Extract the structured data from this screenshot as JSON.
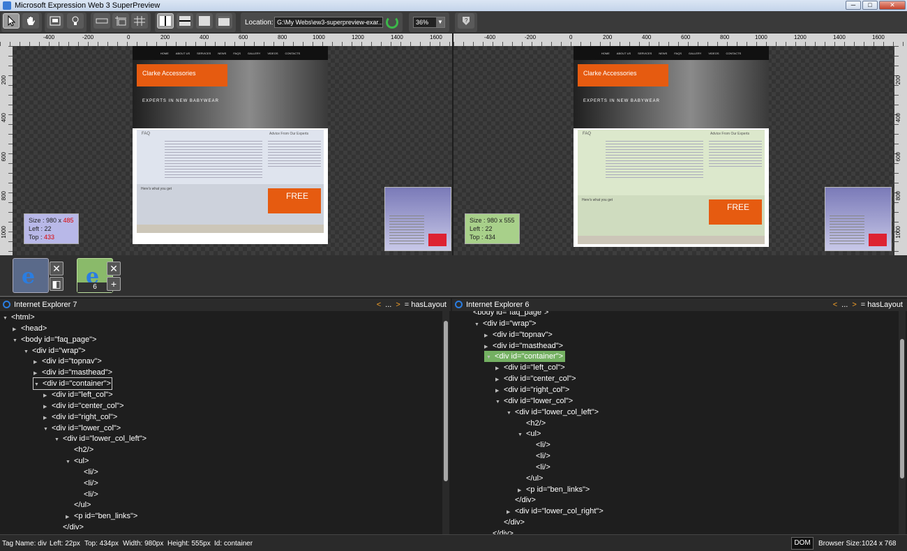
{
  "title": "Microsoft Expression Web 3 SuperPreview",
  "window_buttons": [
    "─",
    "□",
    "✕"
  ],
  "toolbar": {
    "location_label": "Location:",
    "location_value": "G:\\My Webs\\ew3-superpreview-exar...",
    "zoom": "36%"
  },
  "ruler_left": [
    "-400",
    "-200",
    "0",
    "200",
    "400",
    "600",
    "800",
    "1000",
    "1200",
    "1400",
    "1600"
  ],
  "ruler_right": [
    "-400",
    "-200",
    "0",
    "200",
    "400",
    "600",
    "800",
    "1000",
    "1200",
    "1400",
    "1600"
  ],
  "vruler": [
    "200",
    "400",
    "600",
    "800",
    "1000"
  ],
  "site": {
    "nav": [
      "HOME",
      "ABOUT US",
      "SERVICES",
      "NEWS",
      "FAQS",
      "GALLERY",
      "VIDEOS",
      "CONTACTS"
    ],
    "brand": "Clarke Accessories",
    "tagline": "EXPERTS IN NEW BABYWEAR",
    "faq": "FAQ",
    "advice": "Advice From Our Experts",
    "lower": "Here's what you get",
    "free": "FREE"
  },
  "left_info": {
    "size_label": "Size : 980 x ",
    "size_h": "485",
    "left": "Left : 22",
    "top_label": "Top : ",
    "top_val": "433"
  },
  "right_info": {
    "size": "Size : 980 x 555",
    "left": "Left : 22",
    "top": "Top : 434"
  },
  "browser_slot2_count": "6",
  "left_panel": {
    "title": "Internet Explorer 7",
    "nav_prev": "<",
    "nav_dots": "...",
    "nav_next": ">",
    "haslayout": "= hasLayout",
    "rows": [
      {
        "t": "<html>",
        "arrow": "▼"
      },
      {
        "t": "<head>",
        "arrow": "▶"
      },
      {
        "t": "<body id=\"faq_page\">",
        "arrow": "▼"
      },
      {
        "t": "<div id=\"wrap\">",
        "arrow": "▼"
      },
      {
        "t": "<div id=\"topnav\">",
        "arrow": "▶"
      },
      {
        "t": "<div id=\"masthead\">",
        "arrow": "▶"
      },
      {
        "t": "<div id=\"container\">",
        "arrow": "▼"
      },
      {
        "t": "<div id=\"left_col\">",
        "arrow": "▶"
      },
      {
        "t": "<div id=\"center_col\">",
        "arrow": "▶"
      },
      {
        "t": "<div id=\"right_col\">",
        "arrow": "▶"
      },
      {
        "t": "<div id=\"lower_col\">",
        "arrow": "▼"
      },
      {
        "t": "<div id=\"lower_col_left\">",
        "arrow": "▼"
      },
      {
        "t": "<h2/>",
        "arrow": ""
      },
      {
        "t": "<ul>",
        "arrow": "▼"
      },
      {
        "t": "<li/>",
        "arrow": ""
      },
      {
        "t": "<li/>",
        "arrow": ""
      },
      {
        "t": "<li/>",
        "arrow": ""
      },
      {
        "t": "</ul>",
        "arrow": ""
      },
      {
        "t": "<p id=\"ben_links\">",
        "arrow": "▶"
      },
      {
        "t": "</div>",
        "arrow": ""
      }
    ]
  },
  "right_panel": {
    "title": "Internet Explorer 6",
    "nav_prev": "<",
    "nav_dots": "...",
    "nav_next": ">",
    "haslayout": "= hasLayout",
    "rows": [
      {
        "t": "<body id=\"faq_page\">",
        "arrow": ""
      },
      {
        "t": "<div id=\"wrap\">",
        "arrow": "▼"
      },
      {
        "t": "<div id=\"topnav\">",
        "arrow": "▶"
      },
      {
        "t": "<div id=\"masthead\">",
        "arrow": "▶"
      },
      {
        "t": "<div id=\"container\">",
        "arrow": "▼"
      },
      {
        "t": "<div id=\"left_col\">",
        "arrow": "▶"
      },
      {
        "t": "<div id=\"center_col\">",
        "arrow": "▶"
      },
      {
        "t": "<div id=\"right_col\">",
        "arrow": "▶"
      },
      {
        "t": "<div id=\"lower_col\">",
        "arrow": "▼"
      },
      {
        "t": "<div id=\"lower_col_left\">",
        "arrow": "▼"
      },
      {
        "t": "<h2/>",
        "arrow": ""
      },
      {
        "t": "<ul>",
        "arrow": "▼"
      },
      {
        "t": "<li/>",
        "arrow": ""
      },
      {
        "t": "<li/>",
        "arrow": ""
      },
      {
        "t": "<li/>",
        "arrow": ""
      },
      {
        "t": "</ul>",
        "arrow": ""
      },
      {
        "t": "<p id=\"ben_links\">",
        "arrow": "▶"
      },
      {
        "t": "</div>",
        "arrow": ""
      },
      {
        "t": "<div id=\"lower_col_right\">",
        "arrow": "▶"
      },
      {
        "t": "</div>",
        "arrow": ""
      },
      {
        "t": "</div>",
        "arrow": ""
      }
    ]
  },
  "status": {
    "tag": "Tag Name: div",
    "left": "Left: 22px",
    "top": "Top: 434px",
    "width": "Width: 980px",
    "height": "Height: 555px",
    "id": "Id: container",
    "dom": "DOM",
    "browser_size": "Browser Size:",
    "browser_size_val": "1024 x 768"
  },
  "colors": {
    "accent_green": "#74b062",
    "accent_orange": "#f6a028",
    "brand_orange": "#e65b10"
  }
}
